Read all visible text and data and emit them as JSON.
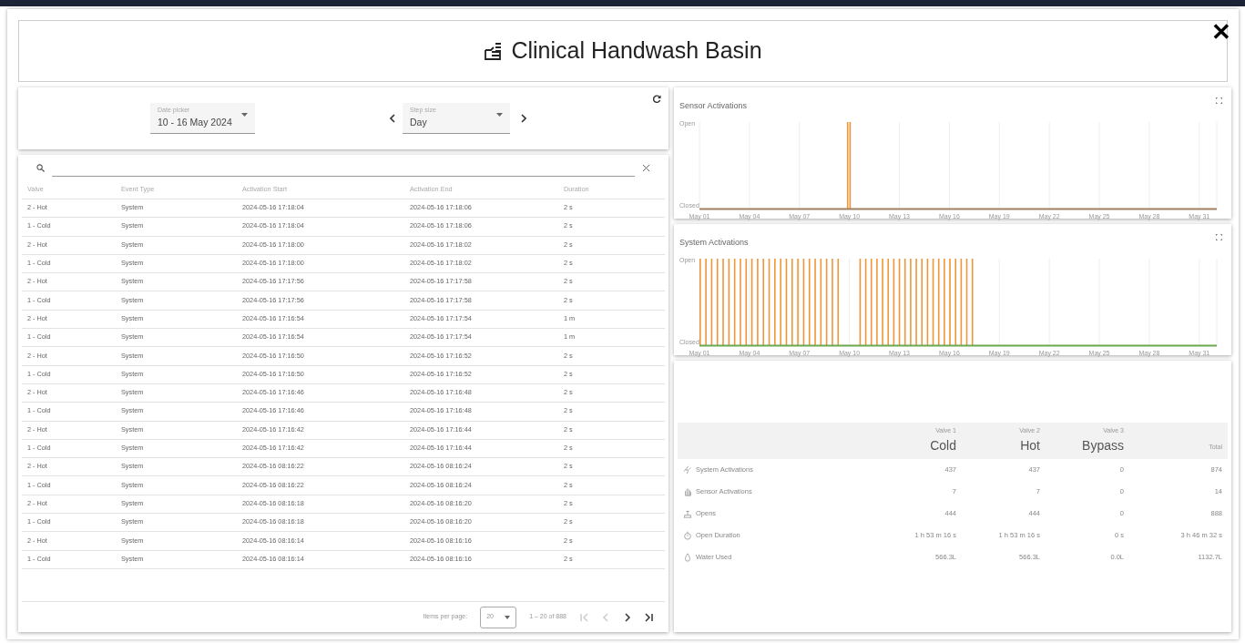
{
  "title": "Clinical Handwash Basin",
  "close_glyph": "✕",
  "filters": {
    "date_picker": {
      "label": "Date picker",
      "value": "10 - 16 May 2024"
    },
    "step_size": {
      "label": "Step size",
      "value": "Day"
    }
  },
  "table": {
    "columns": [
      "Valve",
      "Event Type",
      "Activation Start",
      "Activation End",
      "Duration"
    ],
    "rows": [
      [
        "2 - Hot",
        "System",
        "2024-05-16 17:18:04",
        "2024-05-16 17:18:06",
        "2 s"
      ],
      [
        "1 - Cold",
        "System",
        "2024-05-16 17:18:04",
        "2024-05-16 17:18:06",
        "2 s"
      ],
      [
        "2 - Hot",
        "System",
        "2024-05-16 17:18:00",
        "2024-05-16 17:18:02",
        "2 s"
      ],
      [
        "1 - Cold",
        "System",
        "2024-05-16 17:18:00",
        "2024-05-16 17:18:02",
        "2 s"
      ],
      [
        "2 - Hot",
        "System",
        "2024-05-16 17:17:56",
        "2024-05-16 17:17:58",
        "2 s"
      ],
      [
        "1 - Cold",
        "System",
        "2024-05-16 17:17:56",
        "2024-05-16 17:17:58",
        "2 s"
      ],
      [
        "2 - Hot",
        "System",
        "2024-05-16 17:16:54",
        "2024-05-16 17:17:54",
        "1 m"
      ],
      [
        "1 - Cold",
        "System",
        "2024-05-16 17:16:54",
        "2024-05-16 17:17:54",
        "1 m"
      ],
      [
        "2 - Hot",
        "System",
        "2024-05-16 17:16:50",
        "2024-05-16 17:16:52",
        "2 s"
      ],
      [
        "1 - Cold",
        "System",
        "2024-05-16 17:16:50",
        "2024-05-16 17:16:52",
        "2 s"
      ],
      [
        "2 - Hot",
        "System",
        "2024-05-16 17:16:46",
        "2024-05-16 17:16:48",
        "2 s"
      ],
      [
        "1 - Cold",
        "System",
        "2024-05-16 17:16:46",
        "2024-05-16 17:16:48",
        "2 s"
      ],
      [
        "2 - Hot",
        "System",
        "2024-05-16 17:16:42",
        "2024-05-16 17:16:44",
        "2 s"
      ],
      [
        "1 - Cold",
        "System",
        "2024-05-16 17:16:42",
        "2024-05-16 17:16:44",
        "2 s"
      ],
      [
        "2 - Hot",
        "System",
        "2024-05-16 08:16:22",
        "2024-05-16 08:16:24",
        "2 s"
      ],
      [
        "1 - Cold",
        "System",
        "2024-05-16 08:16:22",
        "2024-05-16 08:16:24",
        "2 s"
      ],
      [
        "2 - Hot",
        "System",
        "2024-05-16 08:16:18",
        "2024-05-16 08:16:20",
        "2 s"
      ],
      [
        "1 - Cold",
        "System",
        "2024-05-16 08:16:18",
        "2024-05-16 08:16:20",
        "2 s"
      ],
      [
        "2 - Hot",
        "System",
        "2024-05-16 08:16:14",
        "2024-05-16 08:16:16",
        "2 s"
      ],
      [
        "1 - Cold",
        "System",
        "2024-05-16 08:16:14",
        "2024-05-16 08:16:16",
        "2 s"
      ]
    ]
  },
  "pagination": {
    "items_per_page_label": "Items per page:",
    "items_per_page": "20",
    "range": "1 – 20 of 888",
    "first_disabled": true,
    "prev_disabled": true,
    "next_disabled": false,
    "last_disabled": false
  },
  "charts": [
    {
      "kind": "sensor",
      "title": "Sensor Activations",
      "y_labels": [
        "Open",
        "Closed"
      ],
      "x_labels": [
        "May 01",
        "May 04",
        "May 07",
        "May 10",
        "May 13",
        "May 16",
        "May 19",
        "May 22",
        "May 25",
        "May 28",
        "May 31"
      ]
    },
    {
      "kind": "system",
      "title": "System Activations",
      "y_labels": [
        "Open",
        "Closed"
      ],
      "x_labels": [
        "May 01",
        "May 04",
        "May 07",
        "May 10",
        "May 13",
        "May 16",
        "May 19",
        "May 22",
        "May 25",
        "May 28",
        "May 31"
      ]
    }
  ],
  "stats": {
    "columns": [
      {
        "sublabel": "Valve 1",
        "label": "Cold"
      },
      {
        "sublabel": "Valve 2",
        "label": "Hot"
      },
      {
        "sublabel": "Valve 3",
        "label": "Bypass"
      },
      {
        "label": "Total"
      }
    ],
    "rows": [
      {
        "kind": "system",
        "label": "System Activations",
        "values": [
          "437",
          "437",
          "0",
          "874"
        ]
      },
      {
        "kind": "sensor",
        "label": "Sensor Activations",
        "values": [
          "7",
          "7",
          "0",
          "14"
        ]
      },
      {
        "kind": "opens",
        "label": "Opens",
        "values": [
          "444",
          "444",
          "0",
          "888"
        ]
      },
      {
        "kind": "duration",
        "label": "Open Duration",
        "values": [
          "1 h 53 m 16 s",
          "1 h 53 m 16 s",
          "0 s",
          "3 h 46 m 32 s"
        ]
      },
      {
        "kind": "water",
        "label": "Water Used",
        "values": [
          "566.3L",
          "566.3L",
          "0.0L",
          "1132.7L"
        ]
      }
    ]
  }
}
